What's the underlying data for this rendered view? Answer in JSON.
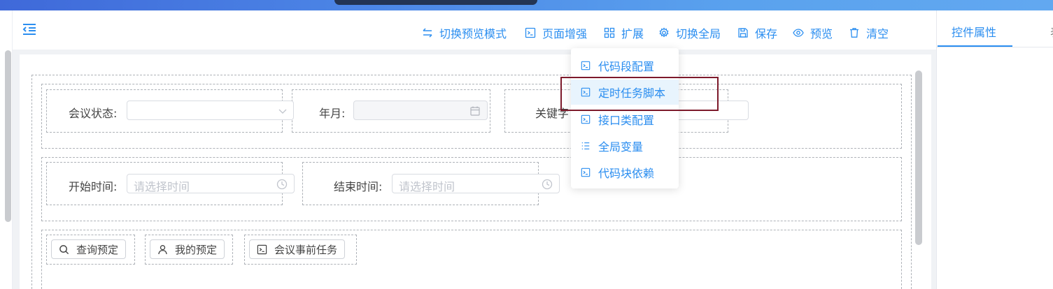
{
  "toolbar": {
    "items": [
      {
        "label": "切换预览模式",
        "icon": "switch-arrows-icon"
      },
      {
        "label": "页面增强",
        "icon": "code-box-icon"
      },
      {
        "label": "扩展",
        "icon": "grid-icon"
      },
      {
        "label": "切换全局",
        "icon": "gear-icon"
      },
      {
        "label": "保存",
        "icon": "save-icon"
      },
      {
        "label": "预览",
        "icon": "eye-icon"
      },
      {
        "label": "清空",
        "icon": "trash-icon"
      }
    ]
  },
  "dropdown": {
    "items": [
      {
        "label": "代码段配置",
        "icon": "code-box-icon"
      },
      {
        "label": "定时任务脚本",
        "icon": "code-box-icon",
        "hovered": true
      },
      {
        "label": "接口类配置",
        "icon": "code-box-icon"
      },
      {
        "label": "全局变量",
        "icon": "list-icon"
      },
      {
        "label": "代码块依赖",
        "icon": "code-box-icon"
      }
    ]
  },
  "right_panel": {
    "tabs": [
      {
        "label": "控件属性",
        "active": true
      },
      {
        "label": "表",
        "active": false
      }
    ]
  },
  "form": {
    "row1": {
      "meeting_status": {
        "label": "会议状态:",
        "value": ""
      },
      "year_month": {
        "label": "年月:",
        "value": ""
      },
      "keyword": {
        "label": "关键字",
        "value": ""
      }
    },
    "row2": {
      "start_time": {
        "label": "开始时间:",
        "placeholder": "请选择时间"
      },
      "end_time": {
        "label": "结束时间:",
        "placeholder": "请选择时间"
      }
    },
    "buttons": [
      {
        "label": "查询预定",
        "icon": "search-icon"
      },
      {
        "label": "我的预定",
        "icon": "user-icon"
      },
      {
        "label": "会议事前任务",
        "icon": "code-box-icon"
      }
    ]
  },
  "colors": {
    "accent": "#2b8ef0",
    "highlight_border": "#7d1a2b",
    "canvas_bg": "#f0f2f5"
  }
}
